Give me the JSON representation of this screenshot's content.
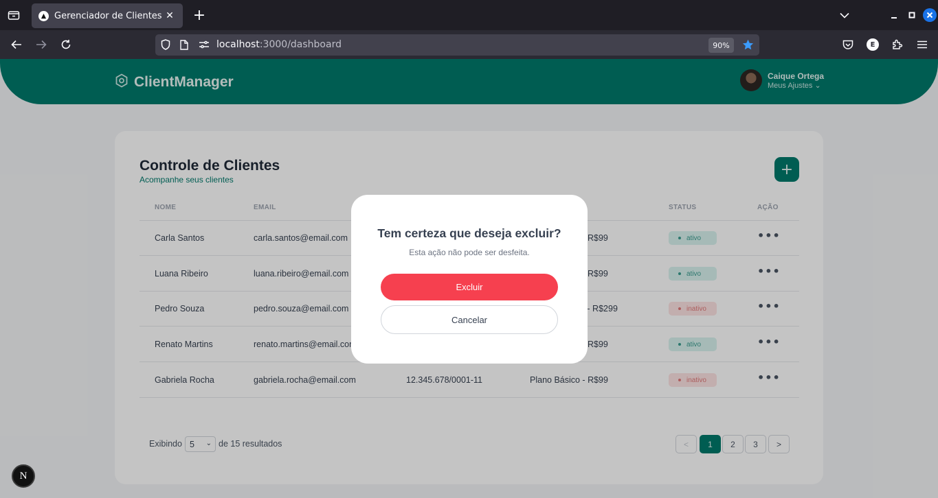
{
  "browser": {
    "tab_title": "Gerenciador de Clientes",
    "new_tab_label": "+",
    "url_host": "localhost",
    "url_path": ":3000/dashboard",
    "zoom": "90%",
    "extension_letter": "E"
  },
  "app": {
    "brand": "ClientManager",
    "user_name": "Caique Ortega",
    "user_menu": "Meus Ajustes"
  },
  "card": {
    "title": "Controle de Clientes",
    "subtitle": "Acompanhe seus clientes",
    "add_label": "+"
  },
  "table": {
    "headers": {
      "name": "NOME",
      "email": "EMAIL",
      "status": "STATUS",
      "action": "AÇÃO"
    },
    "rows": [
      {
        "name": "Carla Santos",
        "email": "carla.santos@email.com",
        "cnpj": "",
        "plan": "R$99",
        "status": "ativo"
      },
      {
        "name": "Luana Ribeiro",
        "email": "luana.ribeiro@email.com",
        "cnpj": "",
        "plan": "R$99",
        "status": "ativo"
      },
      {
        "name": "Pedro Souza",
        "email": "pedro.souza@email.com",
        "cnpj": "",
        "plan": "o - R$299",
        "status": "inativo"
      },
      {
        "name": "Renato Martins",
        "email": "renato.martins@email.com",
        "cnpj": "",
        "plan": "R$99",
        "status": "ativo"
      },
      {
        "name": "Gabriela Rocha",
        "email": "gabriela.rocha@email.com",
        "cnpj": "12.345.678/0001-11",
        "plan": "Plano Básico - R$99",
        "status": "inativo"
      }
    ],
    "action_label": "•••"
  },
  "pagination": {
    "showing": "Exibindo",
    "per_page": "5",
    "results": "de 15 resultados",
    "prev": "<",
    "pages": [
      "1",
      "2",
      "3"
    ],
    "next": ">"
  },
  "modal": {
    "title": "Tem certeza que deseja excluir?",
    "message": "Esta ação não pode ser desfeita.",
    "confirm_label": "Excluir",
    "cancel_label": "Cancelar"
  },
  "dev_badge": "N",
  "colors": {
    "brand": "#00796b",
    "danger": "#f6404f",
    "active_badge": "#d9f2ee",
    "inactive_badge": "#fde3e3"
  }
}
